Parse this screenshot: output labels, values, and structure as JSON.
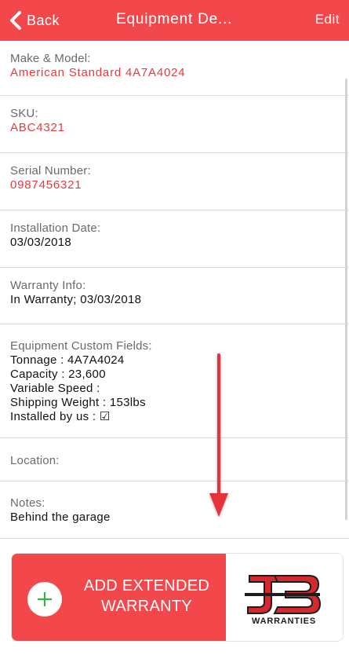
{
  "nav": {
    "back_label": "Back",
    "title": "Equipment De...",
    "edit_label": "Edit"
  },
  "fields": {
    "make_model": {
      "label": "Make & Model:",
      "value": "American Standard 4A7A4024"
    },
    "sku": {
      "label": "SKU:",
      "value": "ABC4321"
    },
    "serial": {
      "label": "Serial Number:",
      "value": "0987456321"
    },
    "installation_date": {
      "label": "Installation Date:",
      "value": "03/03/2018"
    },
    "warranty_info": {
      "label": "Warranty Info:",
      "value": "In Warranty; 03/03/2018"
    },
    "custom_fields": {
      "label": "Equipment Custom Fields:",
      "lines": [
        "Tonnage : 4A7A4024",
        "Capacity : 23,600",
        "Variable Speed :",
        "Shipping Weight : 153lbs",
        "Installed by us : ☑"
      ]
    },
    "location": {
      "label": "Location:"
    },
    "notes": {
      "label": "Notes:",
      "value": "Behind the garage"
    }
  },
  "banner": {
    "line1": "ADD EXTENDED",
    "line2": "WARRANTY",
    "logo_text": "WARRANTIES",
    "logo_letters": "JB"
  },
  "colors": {
    "accent": "#f2474b",
    "link_value": "#e83a3e",
    "plus": "#3fae49",
    "logo_red": "#d42a2f",
    "logo_dark": "#1d1d1d"
  },
  "icons": {
    "back": "chevron-left-icon",
    "plus": "plus-circle-icon",
    "arrow": "arrow-down-icon",
    "logo": "jb-warranties-logo"
  }
}
